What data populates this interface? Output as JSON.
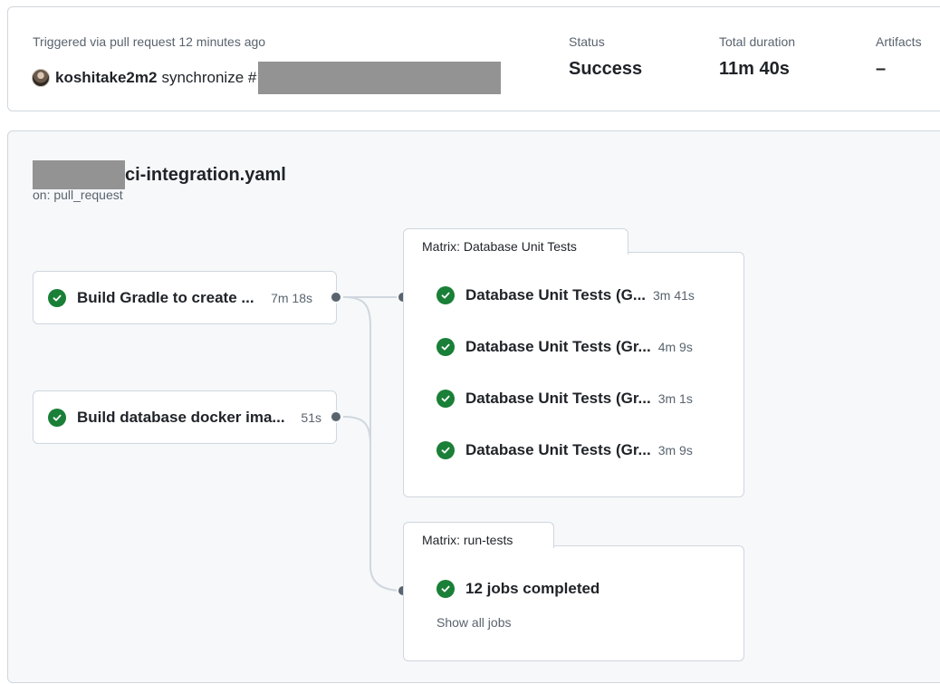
{
  "summary": {
    "trigger_label": "Triggered via pull request 12 minutes ago",
    "user": "koshitake2m2",
    "action": "synchronize #",
    "status_label": "Status",
    "status_value": "Success",
    "duration_label": "Total duration",
    "duration_value": "11m 40s",
    "artifacts_label": "Artifacts",
    "artifacts_value": "–"
  },
  "workflow": {
    "file": "ci-integration.yaml",
    "trigger": "on: pull_request"
  },
  "jobs": [
    {
      "name": "Build Gradle to create ...",
      "duration": "7m 18s"
    },
    {
      "name": "Build database docker ima...",
      "duration": "51s"
    }
  ],
  "matrix_db": {
    "title": "Matrix: Database Unit Tests",
    "jobs": [
      {
        "name": "Database Unit Tests (G...",
        "duration": "3m 41s"
      },
      {
        "name": "Database Unit Tests (Gr...",
        "duration": "4m 9s"
      },
      {
        "name": "Database Unit Tests (Gr...",
        "duration": "3m 1s"
      },
      {
        "name": "Database Unit Tests (Gr...",
        "duration": "3m 9s"
      }
    ]
  },
  "matrix_run": {
    "title": "Matrix: run-tests",
    "summary": "12 jobs completed",
    "link": "Show all jobs"
  },
  "colors": {
    "success": "#1a7f37",
    "border": "#d0d7de",
    "muted": "#59636e",
    "canvas": "#f6f8fa",
    "redacted": "#939393"
  }
}
